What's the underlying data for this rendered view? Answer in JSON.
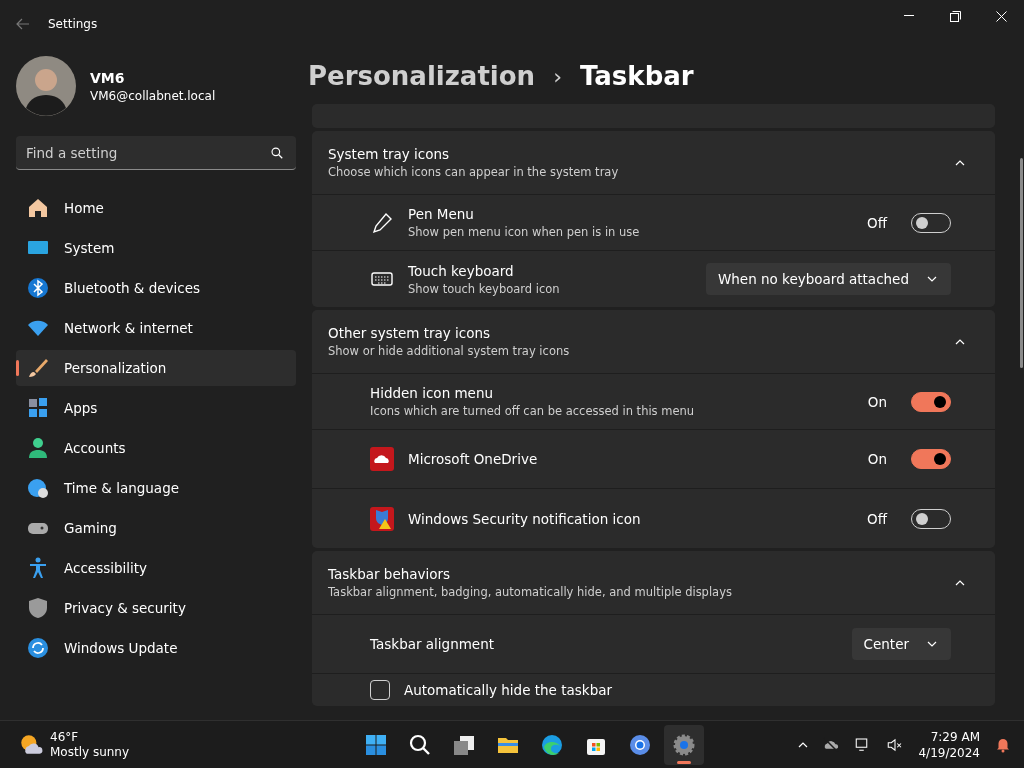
{
  "window": {
    "title": "Settings"
  },
  "user": {
    "name": "VM6",
    "email": "VM6@collabnet.local"
  },
  "search": {
    "placeholder": "Find a setting"
  },
  "nav": [
    {
      "label": "Home",
      "selected": false
    },
    {
      "label": "System",
      "selected": false
    },
    {
      "label": "Bluetooth & devices",
      "selected": false
    },
    {
      "label": "Network & internet",
      "selected": false
    },
    {
      "label": "Personalization",
      "selected": true
    },
    {
      "label": "Apps",
      "selected": false
    },
    {
      "label": "Accounts",
      "selected": false
    },
    {
      "label": "Time & language",
      "selected": false
    },
    {
      "label": "Gaming",
      "selected": false
    },
    {
      "label": "Accessibility",
      "selected": false
    },
    {
      "label": "Privacy & security",
      "selected": false
    },
    {
      "label": "Windows Update",
      "selected": false
    }
  ],
  "breadcrumb": {
    "parent": "Personalization",
    "separator": "›",
    "current": "Taskbar"
  },
  "sections": [
    {
      "title": "System tray icons",
      "subtitle": "Choose which icons can appear in the system tray",
      "expanded": true,
      "rows": [
        {
          "kind": "toggle",
          "label": "Pen Menu",
          "description": "Show pen menu icon when pen is in use",
          "state_text": "Off",
          "on": false
        },
        {
          "kind": "dropdown",
          "label": "Touch keyboard",
          "description": "Show touch keyboard icon",
          "value": "When no keyboard attached"
        }
      ]
    },
    {
      "title": "Other system tray icons",
      "subtitle": "Show or hide additional system tray icons",
      "expanded": true,
      "rows": [
        {
          "kind": "toggle",
          "label": "Hidden icon menu",
          "description": "Icons which are turned off can be accessed in this menu",
          "state_text": "On",
          "on": true
        },
        {
          "kind": "toggle",
          "label": "Microsoft OneDrive",
          "state_text": "On",
          "on": true
        },
        {
          "kind": "toggle",
          "label": "Windows Security notification icon",
          "state_text": "Off",
          "on": false
        }
      ]
    },
    {
      "title": "Taskbar behaviors",
      "subtitle": "Taskbar alignment, badging, automatically hide, and multiple displays",
      "expanded": true,
      "rows": [
        {
          "kind": "dropdown",
          "label": "Taskbar alignment",
          "value": "Center"
        },
        {
          "kind": "checkbox",
          "label": "Automatically hide the taskbar",
          "checked": false
        }
      ]
    }
  ],
  "taskbar": {
    "weather": {
      "temp": "46°F",
      "condition": "Mostly sunny"
    },
    "apps": [
      {
        "active": false
      },
      {
        "active": false
      },
      {
        "active": false
      },
      {
        "active": false
      },
      {
        "active": false
      },
      {
        "active": false
      },
      {
        "active": false
      },
      {
        "active": true
      }
    ],
    "time": "7:29 AM",
    "date": "4/19/2024"
  }
}
